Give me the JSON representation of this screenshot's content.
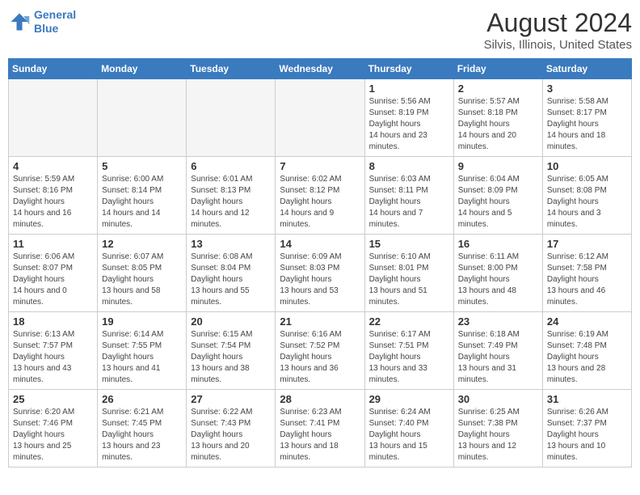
{
  "header": {
    "logo_line1": "General",
    "logo_line2": "Blue",
    "title": "August 2024",
    "subtitle": "Silvis, Illinois, United States"
  },
  "days_of_week": [
    "Sunday",
    "Monday",
    "Tuesday",
    "Wednesday",
    "Thursday",
    "Friday",
    "Saturday"
  ],
  "weeks": [
    [
      {
        "day": "",
        "empty": true
      },
      {
        "day": "",
        "empty": true
      },
      {
        "day": "",
        "empty": true
      },
      {
        "day": "",
        "empty": true
      },
      {
        "day": "1",
        "sunrise": "5:56 AM",
        "sunset": "8:19 PM",
        "daylight": "14 hours and 23 minutes."
      },
      {
        "day": "2",
        "sunrise": "5:57 AM",
        "sunset": "8:18 PM",
        "daylight": "14 hours and 20 minutes."
      },
      {
        "day": "3",
        "sunrise": "5:58 AM",
        "sunset": "8:17 PM",
        "daylight": "14 hours and 18 minutes."
      }
    ],
    [
      {
        "day": "4",
        "sunrise": "5:59 AM",
        "sunset": "8:16 PM",
        "daylight": "14 hours and 16 minutes."
      },
      {
        "day": "5",
        "sunrise": "6:00 AM",
        "sunset": "8:14 PM",
        "daylight": "14 hours and 14 minutes."
      },
      {
        "day": "6",
        "sunrise": "6:01 AM",
        "sunset": "8:13 PM",
        "daylight": "14 hours and 12 minutes."
      },
      {
        "day": "7",
        "sunrise": "6:02 AM",
        "sunset": "8:12 PM",
        "daylight": "14 hours and 9 minutes."
      },
      {
        "day": "8",
        "sunrise": "6:03 AM",
        "sunset": "8:11 PM",
        "daylight": "14 hours and 7 minutes."
      },
      {
        "day": "9",
        "sunrise": "6:04 AM",
        "sunset": "8:09 PM",
        "daylight": "14 hours and 5 minutes."
      },
      {
        "day": "10",
        "sunrise": "6:05 AM",
        "sunset": "8:08 PM",
        "daylight": "14 hours and 3 minutes."
      }
    ],
    [
      {
        "day": "11",
        "sunrise": "6:06 AM",
        "sunset": "8:07 PM",
        "daylight": "14 hours and 0 minutes."
      },
      {
        "day": "12",
        "sunrise": "6:07 AM",
        "sunset": "8:05 PM",
        "daylight": "13 hours and 58 minutes."
      },
      {
        "day": "13",
        "sunrise": "6:08 AM",
        "sunset": "8:04 PM",
        "daylight": "13 hours and 55 minutes."
      },
      {
        "day": "14",
        "sunrise": "6:09 AM",
        "sunset": "8:03 PM",
        "daylight": "13 hours and 53 minutes."
      },
      {
        "day": "15",
        "sunrise": "6:10 AM",
        "sunset": "8:01 PM",
        "daylight": "13 hours and 51 minutes."
      },
      {
        "day": "16",
        "sunrise": "6:11 AM",
        "sunset": "8:00 PM",
        "daylight": "13 hours and 48 minutes."
      },
      {
        "day": "17",
        "sunrise": "6:12 AM",
        "sunset": "7:58 PM",
        "daylight": "13 hours and 46 minutes."
      }
    ],
    [
      {
        "day": "18",
        "sunrise": "6:13 AM",
        "sunset": "7:57 PM",
        "daylight": "13 hours and 43 minutes."
      },
      {
        "day": "19",
        "sunrise": "6:14 AM",
        "sunset": "7:55 PM",
        "daylight": "13 hours and 41 minutes."
      },
      {
        "day": "20",
        "sunrise": "6:15 AM",
        "sunset": "7:54 PM",
        "daylight": "13 hours and 38 minutes."
      },
      {
        "day": "21",
        "sunrise": "6:16 AM",
        "sunset": "7:52 PM",
        "daylight": "13 hours and 36 minutes."
      },
      {
        "day": "22",
        "sunrise": "6:17 AM",
        "sunset": "7:51 PM",
        "daylight": "13 hours and 33 minutes."
      },
      {
        "day": "23",
        "sunrise": "6:18 AM",
        "sunset": "7:49 PM",
        "daylight": "13 hours and 31 minutes."
      },
      {
        "day": "24",
        "sunrise": "6:19 AM",
        "sunset": "7:48 PM",
        "daylight": "13 hours and 28 minutes."
      }
    ],
    [
      {
        "day": "25",
        "sunrise": "6:20 AM",
        "sunset": "7:46 PM",
        "daylight": "13 hours and 25 minutes."
      },
      {
        "day": "26",
        "sunrise": "6:21 AM",
        "sunset": "7:45 PM",
        "daylight": "13 hours and 23 minutes."
      },
      {
        "day": "27",
        "sunrise": "6:22 AM",
        "sunset": "7:43 PM",
        "daylight": "13 hours and 20 minutes."
      },
      {
        "day": "28",
        "sunrise": "6:23 AM",
        "sunset": "7:41 PM",
        "daylight": "13 hours and 18 minutes."
      },
      {
        "day": "29",
        "sunrise": "6:24 AM",
        "sunset": "7:40 PM",
        "daylight": "13 hours and 15 minutes."
      },
      {
        "day": "30",
        "sunrise": "6:25 AM",
        "sunset": "7:38 PM",
        "daylight": "13 hours and 12 minutes."
      },
      {
        "day": "31",
        "sunrise": "6:26 AM",
        "sunset": "7:37 PM",
        "daylight": "13 hours and 10 minutes."
      }
    ]
  ],
  "labels": {
    "sunrise": "Sunrise:",
    "sunset": "Sunset:",
    "daylight": "Daylight hours"
  }
}
